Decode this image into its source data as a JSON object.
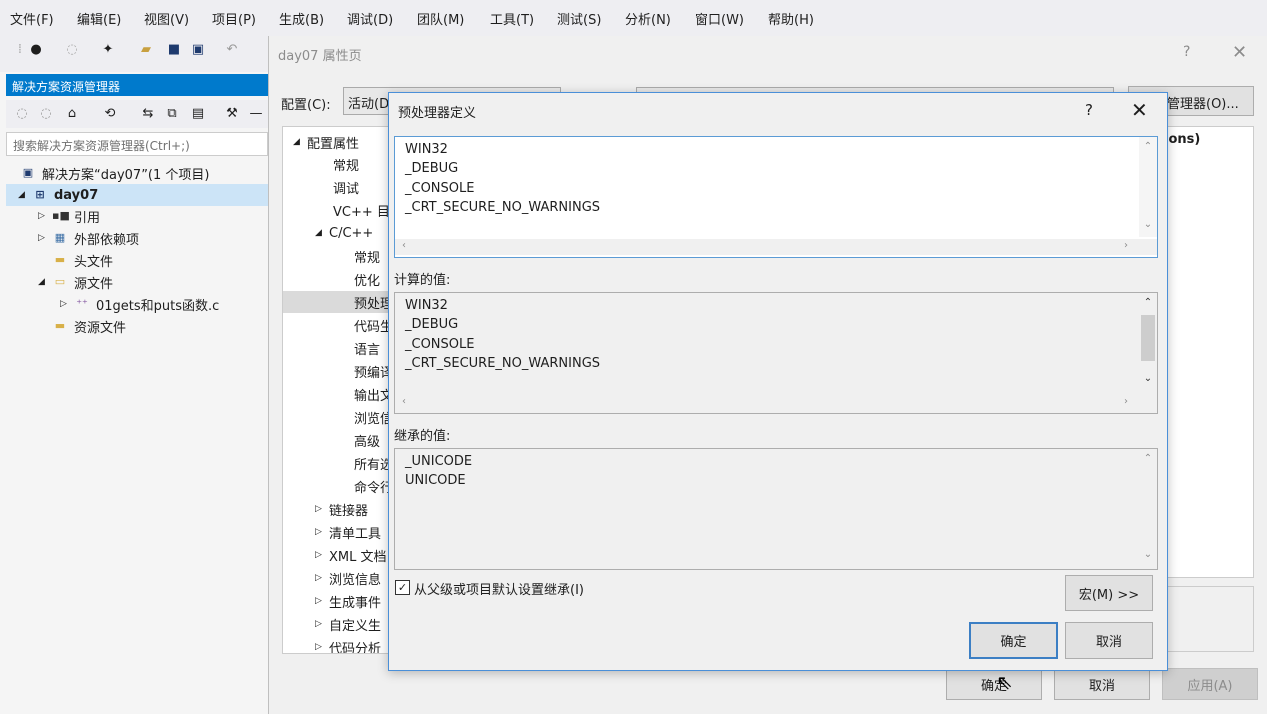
{
  "menubar": {
    "items": [
      "文件(F)",
      "编辑(E)",
      "视图(V)",
      "项目(P)",
      "生成(B)",
      "调试(D)",
      "团队(M)",
      "工具(T)",
      "测试(S)",
      "分析(N)",
      "窗口(W)",
      "帮助(H)"
    ]
  },
  "solution_explorer": {
    "title": "解决方案资源管理器",
    "search_placeholder": "搜索解决方案资源管理器(Ctrl+;)",
    "tree": [
      {
        "label": "解决方案“day07”(1 个项目)",
        "icon": "solution-icon"
      },
      {
        "label": "day07",
        "icon": "project-icon",
        "selected": true
      },
      {
        "label": "引用",
        "icon": "references-icon"
      },
      {
        "label": "外部依赖项",
        "icon": "external-deps-icon"
      },
      {
        "label": "头文件",
        "icon": "folder-icon"
      },
      {
        "label": "源文件",
        "icon": "folder-icon"
      },
      {
        "label": "01gets和puts函数.c",
        "icon": "c-file-icon"
      },
      {
        "label": "资源文件",
        "icon": "folder-icon"
      }
    ]
  },
  "property_pages": {
    "title": "day07 属性页",
    "help": "?",
    "config_label": "配置(C):",
    "config_value": "活动(D",
    "config_manager_button": "管理器(O)...",
    "grid_header": "ions)",
    "tree": [
      "配置属性",
      "常规",
      "调试",
      "VC++ 目",
      "C/C++",
      "常规",
      "优化",
      "预处理",
      "代码生",
      "语言",
      "预编译",
      "输出文",
      "浏览信",
      "高级",
      "所有选",
      "命令行",
      "链接器",
      "清单工具",
      "XML 文档",
      "浏览信息",
      "生成事件",
      "自定义生",
      "代码分析"
    ],
    "ok_button": "确定",
    "cancel_button": "取消",
    "apply_button": "应用(A)"
  },
  "dialog": {
    "title": "预处理器定义",
    "help": "?",
    "definitions": [
      "WIN32",
      "_DEBUG",
      "_CONSOLE",
      "_CRT_SECURE_NO_WARNINGS"
    ],
    "computed_label": "计算的值:",
    "computed_values": [
      "WIN32",
      "_DEBUG",
      "_CONSOLE",
      "_CRT_SECURE_NO_WARNINGS"
    ],
    "inherited_label": "继承的值:",
    "inherited_values": [
      "_UNICODE",
      "UNICODE"
    ],
    "inherit_checkbox_label": "从父级或项目默认设置继承(I)",
    "inherit_checked": true,
    "macros_button": "宏(M) >>",
    "ok_button": "确定",
    "cancel_button": "取消"
  }
}
